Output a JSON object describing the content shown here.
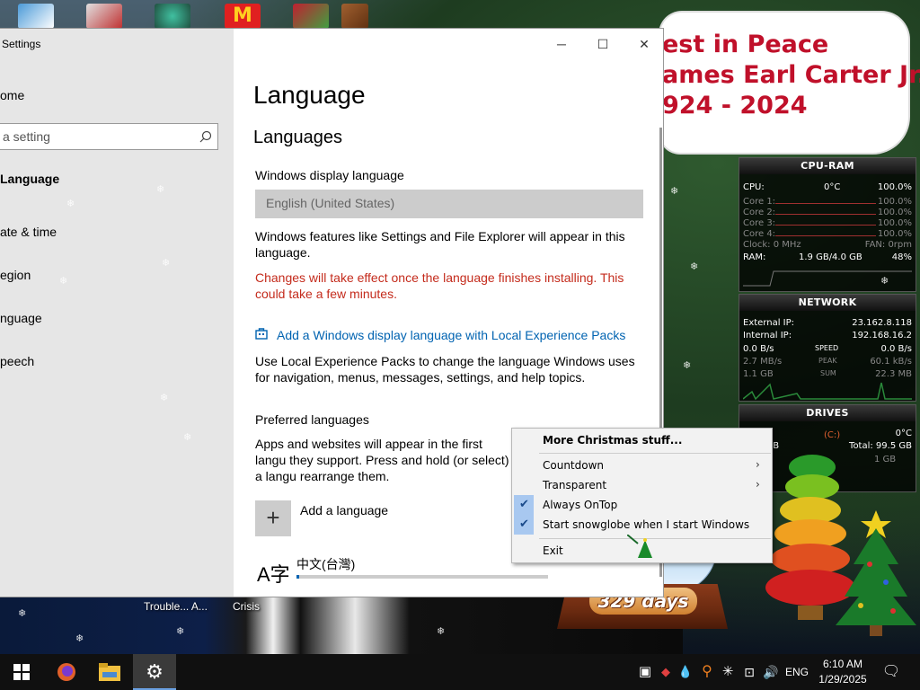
{
  "desktop": {
    "shortcuts_labels": [
      "Trouble... A...",
      "Crisis"
    ],
    "memorial": {
      "line1": "est in Peace",
      "line2": "ames Earl Carter Jr.",
      "line3": "924 - 2024"
    }
  },
  "settings": {
    "app_title": "Settings",
    "sidebar": {
      "home": "ome",
      "search_placeholder": "a setting",
      "section": "Language",
      "items": [
        "ate & time",
        "egion",
        "nguage",
        "peech"
      ]
    },
    "window_controls": {
      "minimize": "─",
      "maximize": "☐",
      "close": "✕"
    },
    "page_title": "Language",
    "section_title": "Languages",
    "display_language_label": "Windows display language",
    "display_language_value": "English (United States)",
    "display_language_desc": "Windows features like Settings and File Explorer will appear in this language.",
    "install_warning": "Changes will take effect once the language finishes installing. This could take a few minutes.",
    "lxp_link": "Add a Windows display language with Local Experience Packs",
    "lxp_desc": "Use Local Experience Packs to change the language Windows uses for navigation, menus, messages, settings, and help topics.",
    "preferred_label": "Preferred languages",
    "preferred_desc": "Apps and websites will appear in the first langu they support. Press and hold (or select) a langu rearrange them.",
    "add_language": "Add a language",
    "installed_language": "中文(台灣)",
    "install_progress": 0.01
  },
  "context_menu": {
    "items": [
      {
        "label": "More Christmas stuff...",
        "bold": true
      },
      {
        "label": "Countdown",
        "submenu": true
      },
      {
        "label": "Transparent",
        "submenu": true
      },
      {
        "label": "Always OnTop",
        "checked": true
      },
      {
        "label": "Start snowglobe when I start Windows",
        "checked": true
      },
      {
        "label": "Exit"
      }
    ]
  },
  "snowglobe": {
    "days": "329 days"
  },
  "gadgets": {
    "cpu": {
      "title": "CPU-RAM",
      "cpu_label": "CPU:",
      "cpu_temp": "0°C",
      "cpu_total": "100.0%",
      "cores": [
        {
          "name": "Core 1:",
          "value": "100.0%"
        },
        {
          "name": "Core 2:",
          "value": "100.0%"
        },
        {
          "name": "Core 3:",
          "value": "100.0%"
        },
        {
          "name": "Core 4:",
          "value": "100.0%"
        }
      ],
      "clock": "Clock: 0 MHz",
      "fan": "FAN: 0rpm",
      "ram_label": "RAM:",
      "ram_value": "1.9 GB/4.0 GB",
      "ram_pct": "48%"
    },
    "network": {
      "title": "NETWORK",
      "external_label": "External IP:",
      "external_ip": "23.162.8.118",
      "internal_label": "Internal IP:",
      "internal_ip": "192.168.16.2",
      "down_speed": "0.0 B/s",
      "speed_label": "SPEED",
      "up_speed": "0.0 B/s",
      "peak_down": "2.7 MB/s",
      "peak_label": "PEAK",
      "peak_up": "60.1 kB/s",
      "sum_down": "1.1 GB",
      "sum_label": "SUM",
      "sum_up": "22.3 MB"
    },
    "drives": {
      "title": "DRIVES",
      "temp": "0°C",
      "drive": "(C:)",
      "used": "25.7 GB",
      "total": "Total: 99.5 GB",
      "free": "1 GB"
    }
  },
  "taskbar": {
    "language": "ENG",
    "time": "6:10 AM",
    "date": "1/29/2025"
  }
}
